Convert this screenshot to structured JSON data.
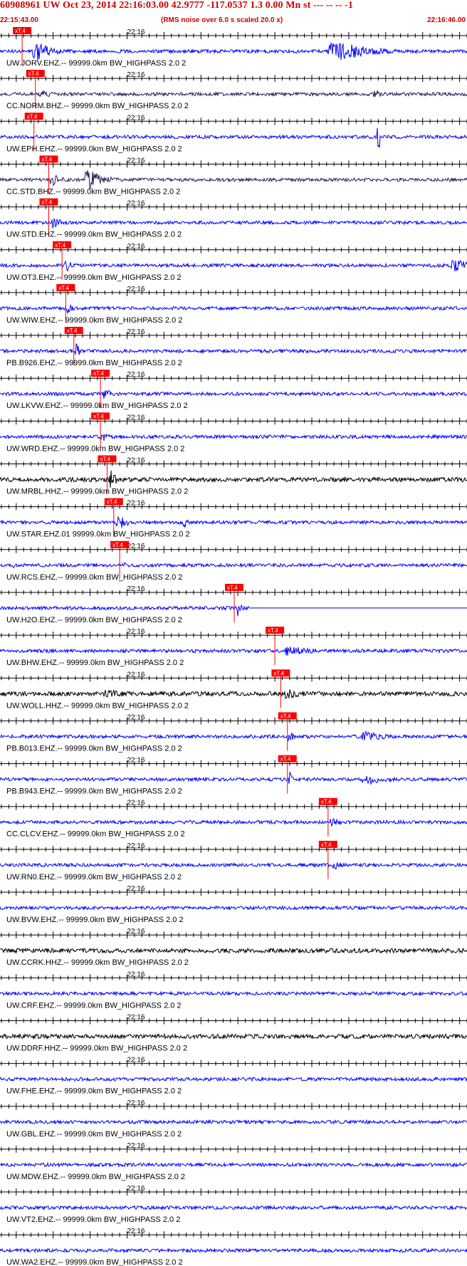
{
  "header": {
    "title": "60908961 UW Oct 23, 2014 22:16:03.00   42.9777 -117.0537  1.3 0.00 Mn st --- -- --   -1",
    "start_time": "22:15:43.00",
    "noise_note": "(RMS noise over 6.0 s scaled 20.0 x)",
    "end_time": "22:16:46.00"
  },
  "colors": {
    "accent": "#cc0000",
    "pick": "#ff0000",
    "trace_blue": "#0000ff",
    "trace_dark": "#2a1a5e",
    "trace_black": "#000000"
  },
  "chart_data": {
    "type": "line",
    "plot": "seismogram section",
    "time_range": [
      "22:15:43.00",
      "22:16:46.00"
    ],
    "minute_tick_label": "22:16",
    "pick_label": "xT.4",
    "traces": [
      {
        "label": "UW.JORV.EHZ.-- 99999.0km BW_HIGHPASS  2.0  2",
        "color": "blue",
        "pick_time": "22:15:45.8",
        "events": [
          {
            "t": "22:15:47.5",
            "amp": 0.9,
            "dur": 5
          },
          {
            "t": "22:16:27.5",
            "amp": 1.0,
            "dur": 11
          }
        ]
      },
      {
        "label": "CC.NORM.BHZ.-- 99999.0km BW_HIGHPASS  2.0  2",
        "color": "dark",
        "pick_time": "22:15:47.6",
        "events": [
          {
            "t": "22:15:48.3",
            "amp": 0.5,
            "dur": 3
          },
          {
            "t": "22:16:33.5",
            "amp": 0.35,
            "dur": 5
          }
        ]
      },
      {
        "label": "UW.EPH.EHZ.-- 99999.0km BW_HIGHPASS  2.0  2",
        "color": "blue",
        "pick_time": "22:15:47.4",
        "events": [
          {
            "t": "22:16:34.0",
            "amp": 1.0,
            "dur": 0.15
          }
        ]
      },
      {
        "label": "CC.STD.BHZ.-- 99999.0km BW_HIGHPASS  2.0  2",
        "color": "dark",
        "pick_time": "22:15:49.4",
        "events": [
          {
            "t": "22:15:49.8",
            "amp": 0.6,
            "dur": 3
          },
          {
            "t": "22:15:54.5",
            "amp": 1.0,
            "dur": 5
          }
        ]
      },
      {
        "label": "UW.STD.EHZ.-- 99999.0km BW_HIGHPASS  2.0  2",
        "color": "blue",
        "pick_time": "22:15:49.4",
        "events": [
          {
            "t": "22:15:50.0",
            "amp": 0.5,
            "dur": 3
          }
        ]
      },
      {
        "label": "UW.OT3.EHZ.-- 99999.0km BW_HIGHPASS  2.0  2",
        "color": "blue",
        "pick_time": "22:15:51.2",
        "events": [
          {
            "t": "22:15:51.8",
            "amp": 0.55,
            "dur": 2
          },
          {
            "t": "22:16:44.0",
            "amp": 0.6,
            "dur": 6
          }
        ]
      },
      {
        "label": "UW.WIW.EHZ.-- 99999.0km BW_HIGHPASS  2.0  2",
        "color": "blue",
        "pick_time": "22:15:51.7",
        "events": [
          {
            "t": "22:15:52.0",
            "amp": 0.45,
            "dur": 2
          }
        ]
      },
      {
        "label": "PB.B926.EHZ.-- 99999.0km BW_HIGHPASS  2.0  2",
        "color": "blue",
        "pick_time": "22:15:52.8",
        "events": [
          {
            "t": "22:15:53.2",
            "amp": 0.9,
            "dur": 0.8
          }
        ]
      },
      {
        "label": "UW.LKVW.EHZ.-- 99999.0km BW_HIGHPASS  2.0  2",
        "color": "blue",
        "pick_time": "22:15:56.4",
        "events": [
          {
            "t": "22:15:56.8",
            "amp": 0.6,
            "dur": 2
          }
        ]
      },
      {
        "label": "UW.WRD.EHZ.-- 99999.0km BW_HIGHPASS  2.0  2",
        "color": "blue",
        "pick_time": "22:15:56.4",
        "events": [
          {
            "t": "22:15:56.7",
            "amp": 0.55,
            "dur": 2
          }
        ]
      },
      {
        "label": "UW.MRBL.HHZ.-- 99999.0km BW_HIGHPASS  2.0  2",
        "color": "black",
        "pick_time": "22:15:57.3",
        "events": [
          {
            "t": "22:15:57.8",
            "amp": 0.8,
            "dur": 2
          },
          {
            "t": "22:16:06.8",
            "amp": 0.3,
            "dur": 1
          }
        ]
      },
      {
        "label": "UW.STAR.EHZ.01 99999.0km BW_HIGHPASS  2.0  2",
        "color": "blue",
        "pick_time": "22:15:58.2",
        "events": [
          {
            "t": "22:15:58.8",
            "amp": 0.7,
            "dur": 3
          },
          {
            "t": "22:16:07.8",
            "amp": 0.5,
            "dur": 1
          }
        ]
      },
      {
        "label": "UW.RCS.EHZ.-- 99999.0km BW_HIGHPASS  2.0  2",
        "color": "blue",
        "pick_time": "22:15:59.0",
        "events": [
          {
            "t": "22:15:44.5",
            "amp": 0.4,
            "dur": 0.6
          },
          {
            "t": "22:15:59.4",
            "amp": 0.35,
            "dur": 1.5
          }
        ]
      },
      {
        "label": "UW.H2O.EHZ.-- 99999.0km BW_HIGHPASS  2.0  2",
        "color": "blue",
        "pick_time": "22:16:14.5",
        "events": [
          {
            "t": "22:16:15.0",
            "amp": 1.0,
            "dur": 0.8
          }
        ],
        "flat_after": "22:16:16.5"
      },
      {
        "label": "UW.BHW.EHZ.-- 99999.0km BW_HIGHPASS  2.0  2",
        "color": "blue",
        "pick_time": "22:16:20.0",
        "events": [
          {
            "t": "22:16:21.5",
            "amp": 0.5,
            "dur": 8
          }
        ]
      },
      {
        "label": "UW.WOLL.HHZ.-- 99999.0km BW_HIGHPASS  2.0  2",
        "color": "black",
        "pick_time": "22:16:20.8",
        "events": [
          {
            "t": "22:15:57.0",
            "amp": 0.45,
            "dur": 8
          },
          {
            "t": "22:16:21.5",
            "amp": 0.55,
            "dur": 5
          }
        ]
      },
      {
        "label": "PB.B013.EHZ.-- 99999.0km BW_HIGHPASS  2.0  2",
        "color": "blue",
        "pick_time": "22:16:21.7",
        "events": [
          {
            "t": "22:16:22.0",
            "amp": 0.7,
            "dur": 1
          },
          {
            "t": "22:16:32.0",
            "amp": 0.5,
            "dur": 7
          }
        ]
      },
      {
        "label": "PB.B943.EHZ.-- 99999.0km BW_HIGHPASS  2.0  2",
        "color": "blue",
        "pick_time": "22:16:21.7",
        "events": [
          {
            "t": "22:16:22.0",
            "amp": 0.7,
            "dur": 1
          },
          {
            "t": "22:16:32.0",
            "amp": 0.55,
            "dur": 7
          }
        ]
      },
      {
        "label": "CC.CLCV.EHZ.-- 99999.0km BW_HIGHPASS  2.0  2",
        "color": "blue",
        "pick_time": "22:16:27.2",
        "events": [
          {
            "t": "22:16:27.5",
            "amp": 0.45,
            "dur": 3
          }
        ]
      },
      {
        "label": "UW.RN0.EHZ.-- 99999.0km BW_HIGHPASS  2.0  2",
        "color": "blue",
        "pick_time": "22:16:27.2",
        "events": [
          {
            "t": "22:16:28.0",
            "amp": 0.4,
            "dur": 4
          }
        ]
      },
      {
        "label": "UW.BVW.EHZ.-- 99999.0km BW_HIGHPASS  2.0  2",
        "color": "blue",
        "events": []
      },
      {
        "label": "UW.CCRK.HHZ.-- 99999.0km BW_HIGHPASS  2.0  2",
        "color": "black",
        "events": []
      },
      {
        "label": "UW.CRF.EHZ.-- 99999.0km BW_HIGHPASS  2.0  2",
        "color": "blue",
        "events": []
      },
      {
        "label": "UW.DDRF.HHZ.-- 99999.0km BW_HIGHPASS  2.0  2",
        "color": "black",
        "events": []
      },
      {
        "label": "UW.FHE.EHZ.-- 99999.0km BW_HIGHPASS  2.0  2",
        "color": "blue",
        "events": []
      },
      {
        "label": "UW.GBL.EHZ.-- 99999.0km BW_HIGHPASS  2.0  2",
        "color": "blue",
        "events": []
      },
      {
        "label": "UW.MDW.EHZ.-- 99999.0km BW_HIGHPASS  2.0  2",
        "color": "blue",
        "events": []
      },
      {
        "label": "UW.VT2.EHZ.-- 99999.0km BW_HIGHPASS  2.0  2",
        "color": "blue",
        "events": []
      },
      {
        "label": "UW.WA2.EHZ.-- 99999.0km BW_HIGHPASS  2.0  2",
        "color": "blue",
        "events": []
      }
    ]
  }
}
